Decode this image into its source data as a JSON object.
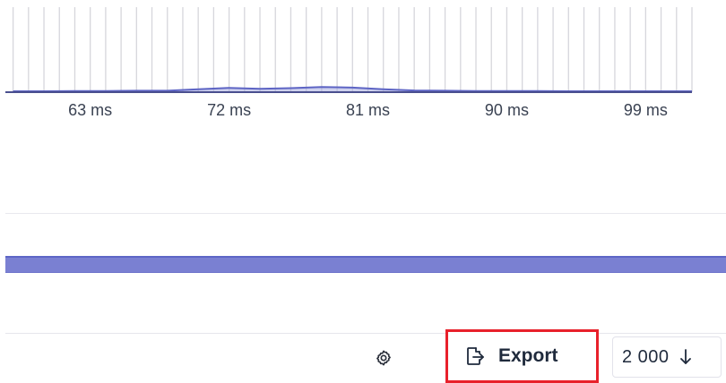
{
  "chart_data": {
    "type": "area",
    "x": [
      58,
      60,
      62,
      64,
      66,
      68,
      70,
      72,
      74,
      76,
      78,
      80,
      82,
      84,
      86,
      88,
      90,
      92,
      94,
      96,
      98,
      100,
      102
    ],
    "values": [
      0.3,
      0.3,
      0.4,
      0.4,
      0.5,
      0.5,
      1.0,
      1.5,
      1.2,
      1.4,
      1.8,
      1.6,
      1.0,
      0.6,
      0.5,
      0.4,
      0.4,
      0.4,
      0.3,
      0.3,
      0.3,
      0.3,
      0.3
    ],
    "xlim": [
      57.5,
      102
    ],
    "tick_values": [
      63,
      72,
      81,
      90,
      99
    ],
    "tick_labels": [
      "63 ms",
      "72 ms",
      "81 ms",
      "90 ms",
      "99 ms"
    ],
    "grid": true,
    "series_color": "#6b71c9"
  },
  "toolbar": {
    "settings_icon": "gear-icon",
    "export_icon": "export-file-icon",
    "export_label": "Export",
    "export_highlight_color": "#e8212b",
    "count_value": "2 000",
    "sort_icon": "arrow-down-icon"
  },
  "colors": {
    "band": "#7a80d2",
    "divider": "#e8e8ee"
  }
}
